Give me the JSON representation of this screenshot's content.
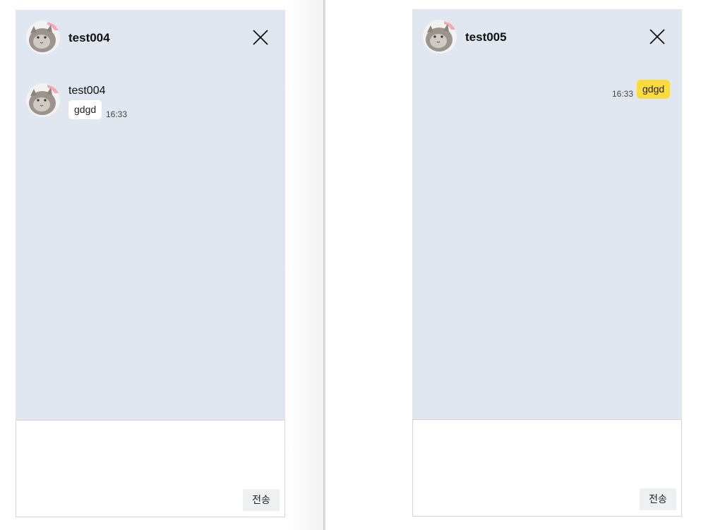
{
  "left_chat": {
    "header_name": "test004",
    "messages": [
      {
        "sender": "test004",
        "text": "gdgd",
        "time": "16:33"
      }
    ],
    "input_placeholder": "",
    "send_label": "전송"
  },
  "right_chat": {
    "header_name": "test005",
    "messages": [
      {
        "text": "gdgd",
        "time": "16:33"
      }
    ],
    "input_placeholder": "",
    "send_label": "전송"
  },
  "colors": {
    "chat_background": "#e1e7f0",
    "own_bubble": "#fbdb3e",
    "other_bubble": "#ffffff",
    "send_button": "#eef0f2"
  },
  "icons": {
    "avatar": "cat-avatar-icon",
    "close": "close-icon"
  }
}
